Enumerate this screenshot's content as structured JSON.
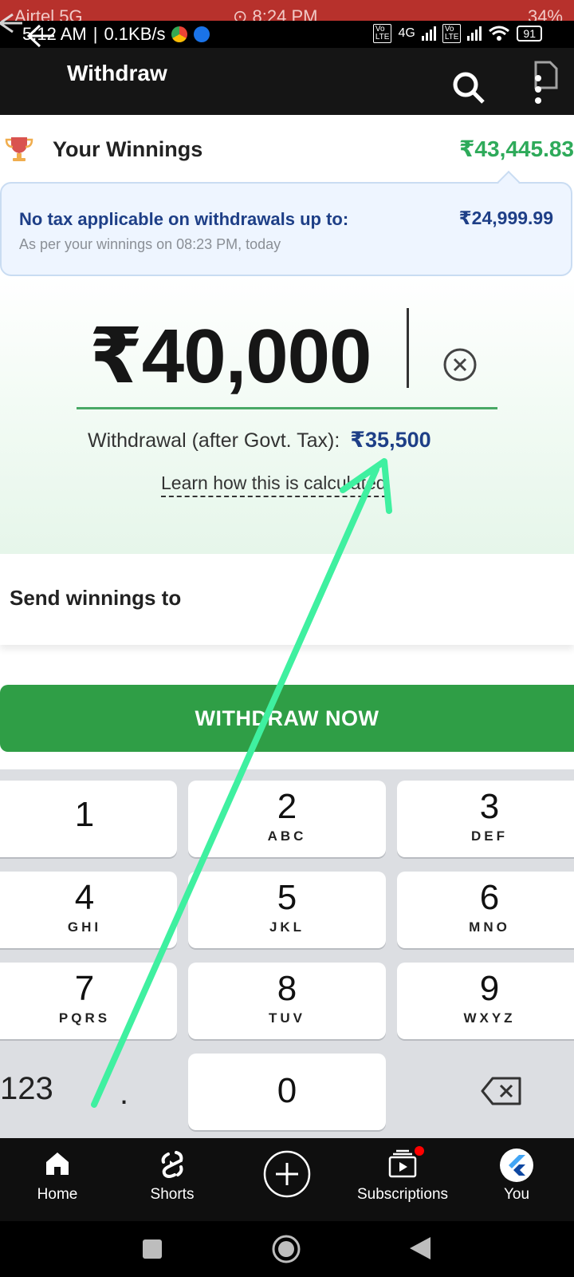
{
  "recorded_status": {
    "carrier": "Airtel 5G",
    "time": "8:24 PM",
    "battery": "34%"
  },
  "status_bar": {
    "time": "5:12 AM",
    "speed": "0.1KB/s",
    "network": "4G",
    "battery": "91"
  },
  "header": {
    "title": "Withdraw"
  },
  "winnings": {
    "label": "Your Winnings",
    "amount": "₹43,445.83"
  },
  "tax_info": {
    "title": "No tax applicable on withdrawals up to:",
    "subtitle": "As per your winnings on 08:23 PM, today",
    "amount": "₹24,999.99"
  },
  "entry": {
    "amount": "₹40,000",
    "after_tax_label": "Withdrawal (after Govt. Tax):",
    "after_tax_value": "₹35,500",
    "learn_link": "Learn how this is calculated"
  },
  "send": {
    "label": "Send winnings to"
  },
  "withdraw_button": {
    "label": "WITHDRAW NOW"
  },
  "keypad": {
    "keys": [
      {
        "num": "1",
        "letters": ""
      },
      {
        "num": "2",
        "letters": "ABC"
      },
      {
        "num": "3",
        "letters": "DEF"
      },
      {
        "num": "4",
        "letters": "GHI"
      },
      {
        "num": "5",
        "letters": "JKL"
      },
      {
        "num": "6",
        "letters": "MNO"
      },
      {
        "num": "7",
        "letters": "PQRS"
      },
      {
        "num": "8",
        "letters": "TUV"
      },
      {
        "num": "9",
        "letters": "WXYZ"
      },
      {
        "num": "0",
        "letters": ""
      }
    ],
    "symbols_key": "123",
    "dot_key": "."
  },
  "bottom_nav": {
    "home": "Home",
    "shorts": "Shorts",
    "subscriptions": "Subscriptions",
    "you": "You"
  },
  "colors": {
    "accent_green": "#2f9e46",
    "winnings_green": "#2eaa5a",
    "tax_blue": "#1e3f87",
    "annotation_arrow": "#3ff0a0"
  }
}
